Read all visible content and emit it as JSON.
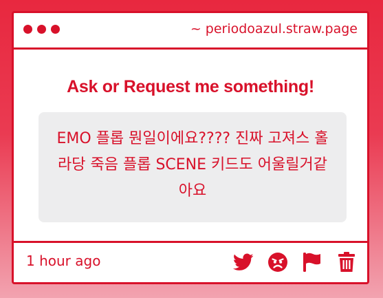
{
  "window": {
    "url": "~ periodoazul.straw.page"
  },
  "prompt": "Ask or Request me something!",
  "question": {
    "text": "EMO 플롭 뭔일이에요???? 진짜 고져스 홀라당 죽음 플롭 SCENE 키드도 어울릴거같아요"
  },
  "footer": {
    "time": "1 hour ago",
    "actions": [
      "twitter-icon",
      "angry-face-icon",
      "flag-icon",
      "trash-icon"
    ]
  },
  "colors": {
    "accent": "#d8112a",
    "bubble": "#ededee"
  }
}
